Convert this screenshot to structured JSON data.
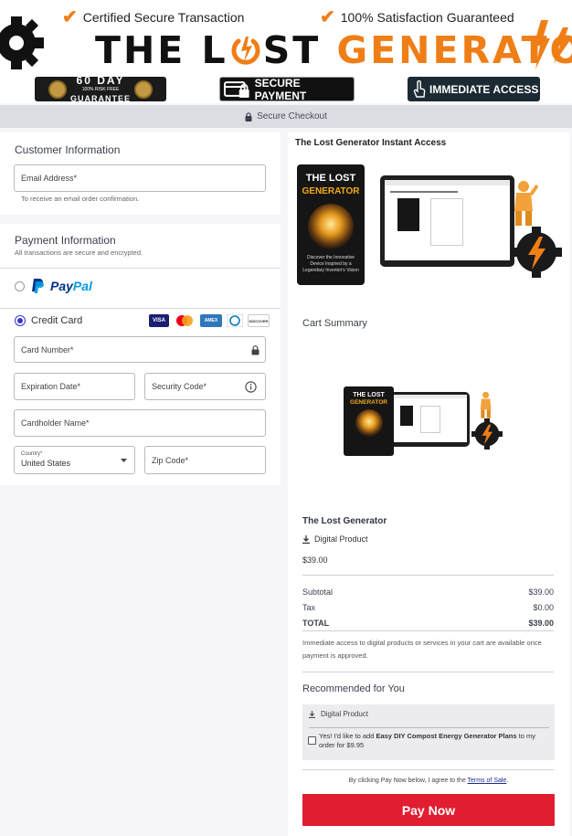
{
  "header": {
    "cert_left": "Certified Secure Transaction",
    "cert_right": "100% Satisfaction Guaranteed",
    "brand_part1": "THE L",
    "brand_part2": "ST ",
    "brand_part3": "GENERATOR",
    "badge_60_big": "60 DAY",
    "badge_60_small": "100% RISK FREE",
    "badge_60_guarantee": "GUARANTEE",
    "badge_secure": "SECURE PAYMENT",
    "badge_access": "IMMEDIATE ACCESS"
  },
  "secure_bar": {
    "label": "Secure Checkout"
  },
  "customer": {
    "title": "Customer Information",
    "email_label": "Email Address*",
    "email_hint": "To receive an email order confirmation."
  },
  "payment": {
    "title": "Payment Information",
    "subtitle": "All transactions are secure and encrypted.",
    "paypal_pay": "Pay",
    "paypal_pal": "Pal",
    "credit_card_label": "Credit Card",
    "card_visa": "VISA",
    "card_amex": "AMEX",
    "card_discover": "DISCOVER",
    "card_number_label": "Card Number*",
    "expiration_label": "Expiration Date*",
    "security_label": "Security Code*",
    "cardholder_label": "Cardholder Name*",
    "country_label": "Country*",
    "country_value": "United States",
    "zip_label": "Zip Code*"
  },
  "summary": {
    "product_title": "The Lost Generator Instant Access",
    "ebook_title1": "THE LOST",
    "ebook_title2": "GENERATOR",
    "ebook_tagline": "Discover the Innovative Device Inspired by a Legendary Inventor's Vision",
    "cart_summary": "Cart Summary",
    "item_name": "The Lost Generator",
    "item_type": "Digital Product",
    "item_price": "$39.00",
    "subtotal_label": "Subtotal",
    "subtotal_value": "$39.00",
    "tax_label": "Tax",
    "tax_value": "$0.00",
    "total_label": "TOTAL",
    "total_value": "$39.00",
    "note": "Immediate access to digital products or services in your cart are available once payment is approved.",
    "recommended_title": "Recommended for You",
    "rec_type": "Digital Product",
    "rec_text_prefix": "Yes! I'd like to add ",
    "rec_text_bold": "Easy DIY Compost Energy Generator Plans",
    "rec_text_suffix": " to my order for $9.95",
    "terms_prefix": "By clicking Pay Now below, I agree to the ",
    "terms_link": "Terms of Sale",
    "terms_suffix": ".",
    "pay_now": "Pay Now"
  },
  "colors": {
    "accent_orange": "#f07e16",
    "pay_red": "#e21d31",
    "paypal_dark": "#003087",
    "paypal_light": "#009cde"
  }
}
